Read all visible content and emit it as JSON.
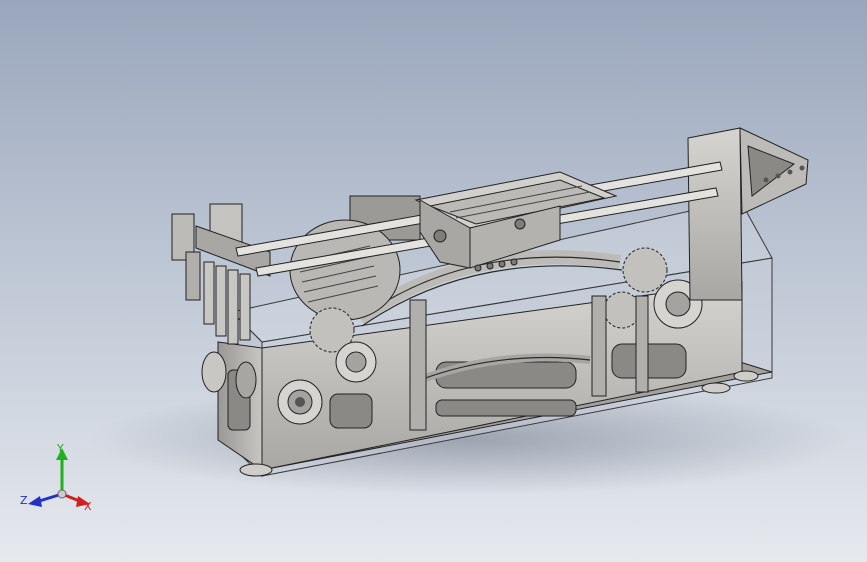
{
  "viewport": {
    "background_top": "#9aa6bc",
    "background_bottom": "#e6e9ee"
  },
  "triad": {
    "x_label": "X",
    "y_label": "Y",
    "z_label": "Z",
    "x_color": "#d02020",
    "y_color": "#20b020",
    "z_color": "#2030c8",
    "icon": "coordinate-triad-icon"
  },
  "model": {
    "icon": "cad-assembly-machine",
    "metal_color": "#b8b6b2",
    "metal_shadow": "#8e8c88",
    "glass_color": "#c9d1dc"
  }
}
